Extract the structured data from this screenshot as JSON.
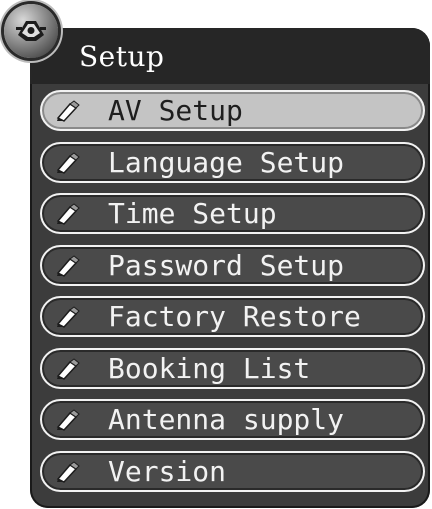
{
  "window": {
    "title": "Setup",
    "logo_icon": "setup-gear-icon"
  },
  "menu": {
    "selected_index": 0,
    "item_icon": "pencil-icon",
    "items": [
      {
        "label": "AV Setup"
      },
      {
        "label": "Language Setup"
      },
      {
        "label": "Time Setup"
      },
      {
        "label": "Password Setup"
      },
      {
        "label": "Factory Restore"
      },
      {
        "label": "Booking List"
      },
      {
        "label": "Antenna supply"
      },
      {
        "label": "Version"
      }
    ]
  },
  "colors": {
    "panel": "#3c3c3c",
    "item_bg": "#4a4a4a",
    "item_selected_bg": "#c4c4c4",
    "item_border": "#f2f2f2",
    "text": "#f2f2f2",
    "selected_text": "#1e1e1e"
  }
}
